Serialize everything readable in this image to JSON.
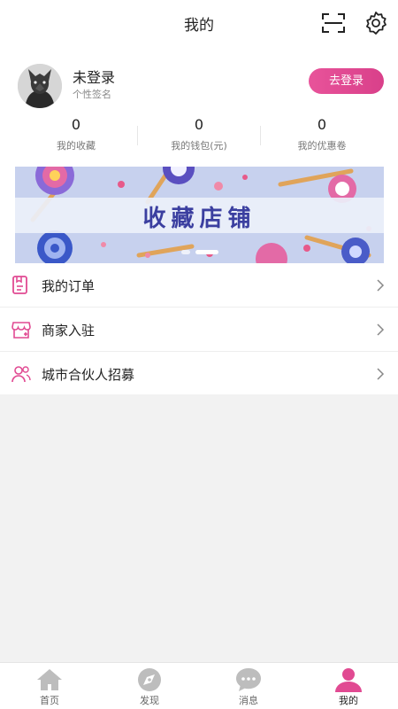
{
  "header": {
    "title": "我的"
  },
  "profile": {
    "name": "未登录",
    "signature": "个性签名",
    "login_label": "去登录"
  },
  "stats": [
    {
      "value": "0",
      "label": "我的收藏"
    },
    {
      "value": "0",
      "label": "我的钱包(元)"
    },
    {
      "value": "0",
      "label": "我的优惠卷"
    }
  ],
  "banner": {
    "text": "收藏店铺",
    "slide_count": 2,
    "active_slide": 2
  },
  "menu": [
    {
      "label": "我的订单",
      "icon": "order-icon"
    },
    {
      "label": "商家入驻",
      "icon": "store-icon"
    },
    {
      "label": "城市合伙人招募",
      "icon": "partner-icon"
    }
  ],
  "tabs": [
    {
      "label": "首页",
      "icon": "home-icon"
    },
    {
      "label": "发现",
      "icon": "compass-icon"
    },
    {
      "label": "消息",
      "icon": "chat-icon"
    },
    {
      "label": "我的",
      "icon": "user-icon"
    }
  ],
  "colors": {
    "accent": "#e14a92",
    "tab_inactive": "#bdbdbd",
    "banner_text": "#3b3fa0"
  }
}
